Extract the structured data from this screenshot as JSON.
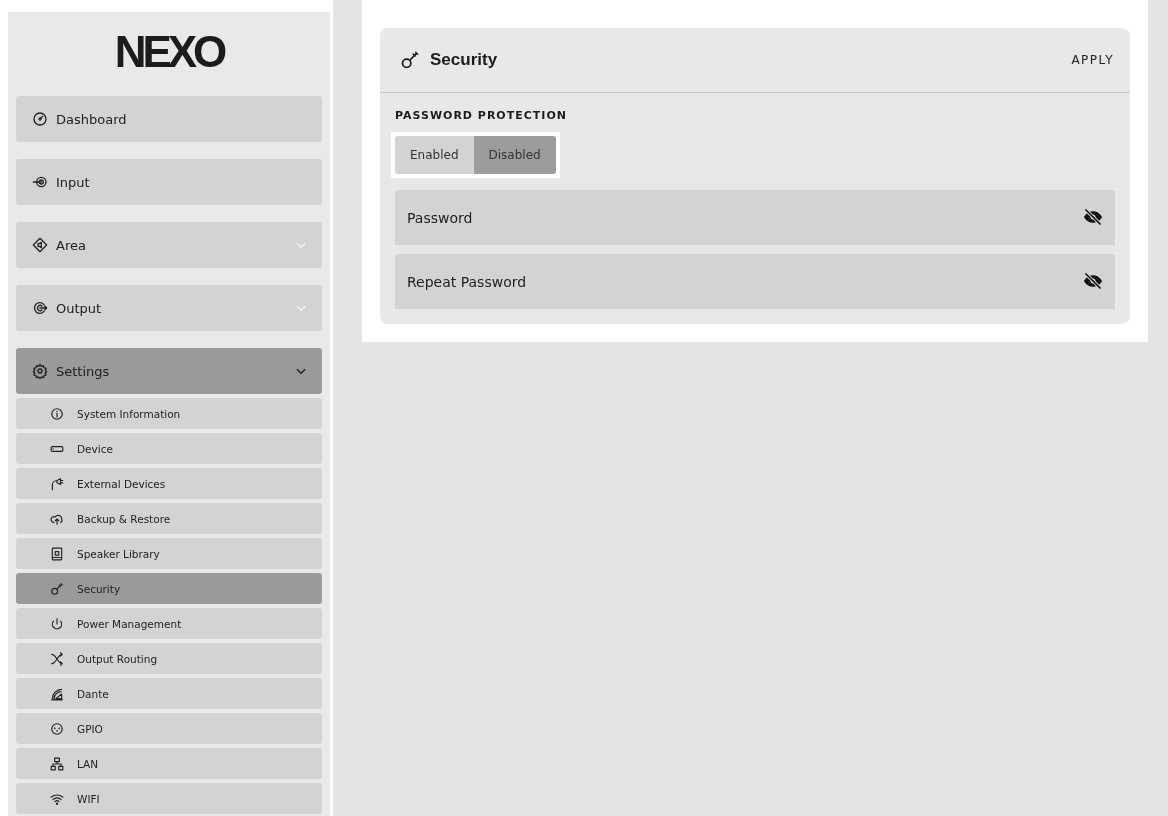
{
  "sidebar": {
    "logo": "NEXO",
    "items": [
      {
        "label": "Dashboard",
        "selected": false
      },
      {
        "label": "Input",
        "selected": false
      },
      {
        "label": "Area",
        "expanded": false,
        "selected": false
      },
      {
        "label": "Output",
        "expanded": false,
        "selected": false
      },
      {
        "label": "Settings",
        "expanded": true,
        "selected": true,
        "children": [
          {
            "label": "System Information",
            "selected": false
          },
          {
            "label": "Device",
            "selected": false
          },
          {
            "label": "External Devices",
            "selected": false
          },
          {
            "label": "Backup & Restore",
            "selected": false
          },
          {
            "label": "Speaker Library",
            "selected": false
          },
          {
            "label": "Security",
            "selected": true
          },
          {
            "label": "Power Management",
            "selected": false
          },
          {
            "label": "Output Routing",
            "selected": false
          },
          {
            "label": "Dante",
            "selected": false
          },
          {
            "label": "GPIO",
            "selected": false
          },
          {
            "label": "LAN",
            "selected": false
          },
          {
            "label": "WIFI",
            "selected": false
          }
        ]
      }
    ]
  },
  "card": {
    "title": "Security",
    "action": "APPLY",
    "section_label": "PASSWORD PROTECTION",
    "options": [
      {
        "label": "Enabled",
        "selected": false
      },
      {
        "label": "Disabled",
        "selected": true
      }
    ],
    "fields": [
      {
        "placeholder": "Password"
      },
      {
        "placeholder": "Repeat Password"
      }
    ]
  }
}
